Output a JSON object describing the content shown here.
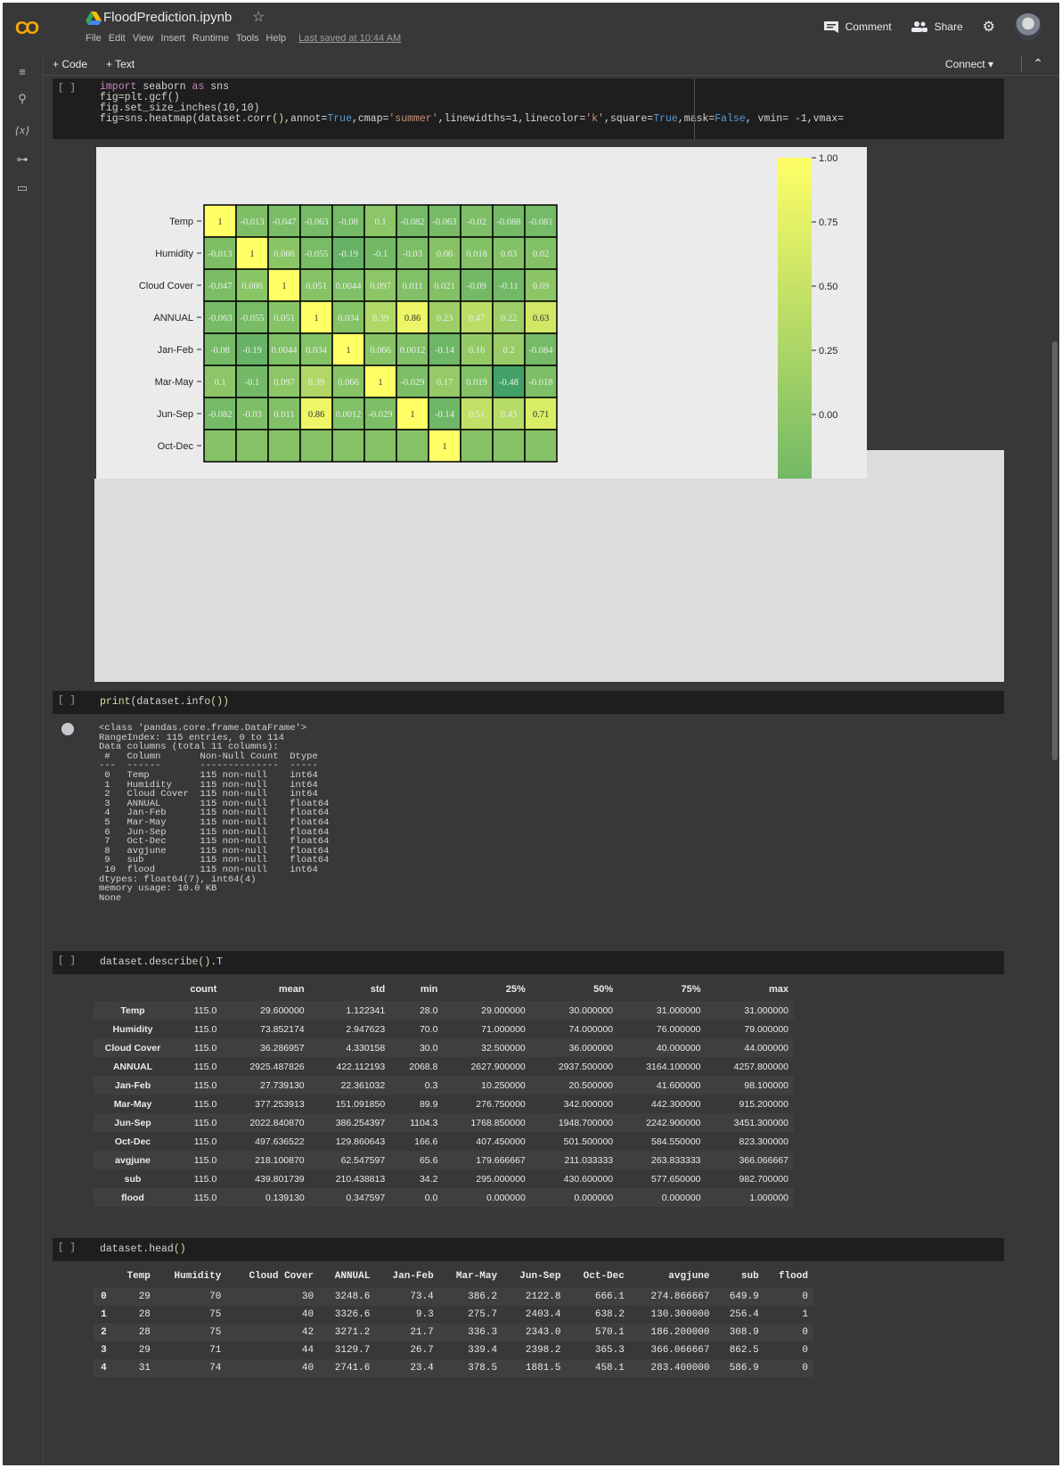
{
  "app": {
    "logo": "CO",
    "notebook_title": "FloodPrediction.ipynb",
    "menu": [
      "File",
      "Edit",
      "View",
      "Insert",
      "Runtime",
      "Tools",
      "Help"
    ],
    "last_saved": "Last saved at 10:44 AM",
    "comment_label": "Comment",
    "share_label": "Share"
  },
  "toolbar": {
    "code_label": "+ Code",
    "text_label": "+ Text",
    "connect_label": "Connect"
  },
  "cells": {
    "run_indicator": "[ ]",
    "heatmap_code": {
      "line1_kw": "import",
      "line1_rest": " seaborn ",
      "line1_kw2": "as",
      "line1_end": " sns",
      "line2": "fig=plt.gcf()",
      "line3": "fig.set_size_inches(10,10)",
      "line4_a": "fig=sns.heatmap(dataset.corr",
      "line4_paren": "()",
      "line4_b": ",annot=",
      "line4_true": "True",
      "line4_c": ",cmap=",
      "line4_cmap": "'summer'",
      "line4_d": ",linewidths=1,linecolor=",
      "line4_k": "'k'",
      "line4_e": ",square=",
      "line4_true2": "True",
      "line4_f": ",mask=",
      "line4_false": "False",
      "line4_g": ", vmin= -1,vmax="
    },
    "info_code": {
      "fn": "print",
      "rest": "(dataset.info",
      "paren": "())"
    },
    "describe_code": {
      "a": "dataset.describe",
      "paren": "()",
      "b": ".T"
    },
    "head_code": {
      "a": "dataset.head",
      "paren": "()"
    }
  },
  "chart_data": {
    "type": "heatmap",
    "row_labels": [
      "Temp",
      "Humidity",
      "Cloud Cover",
      "ANNUAL",
      "Jan-Feb",
      "Mar-May",
      "Jun-Sep",
      "Oct-Dec"
    ],
    "values": [
      [
        "1",
        "-0.013",
        "-0.047",
        "-0.063",
        "-0.08",
        "0.1",
        "-0.082",
        "-0.063",
        "-0.02",
        "-0.088",
        "-0.081"
      ],
      [
        "-0.013",
        "1",
        "0.086",
        "-0.055",
        "-0.19",
        "-0.1",
        "-0.03",
        "0.06",
        "0.018",
        "0.03",
        "0.02"
      ],
      [
        "-0.047",
        "0.086",
        "1",
        "0.051",
        "0.0044",
        "0.097",
        "0.011",
        "0.021",
        "-0.09",
        "-0.11",
        "0.09"
      ],
      [
        "-0.063",
        "-0.055",
        "0.051",
        "1",
        "0.034",
        "0.39",
        "0.86",
        "0.23",
        "0.47",
        "0.22",
        "0.63"
      ],
      [
        "-0.08",
        "-0.19",
        "0.0044",
        "0.034",
        "1",
        "0.066",
        "0.0012",
        "-0.14",
        "0.16",
        "0.2",
        "-0.084"
      ],
      [
        "0.1",
        "-0.1",
        "0.097",
        "0.39",
        "0.066",
        "1",
        "-0.029",
        "0.17",
        "0.019",
        "-0.48",
        "-0.018"
      ],
      [
        "-0.082",
        "-0.03",
        "0.011",
        "0.86",
        "0.0012",
        "-0.029",
        "1",
        "-0.14",
        "0.51",
        "0.43",
        "0.71"
      ],
      [
        "",
        "",
        "",
        "",
        "",
        "",
        "",
        "1",
        "",
        "",
        ""
      ]
    ],
    "colorbar_ticks": [
      "1.00",
      "0.75",
      "0.50",
      "0.25",
      "0.00"
    ],
    "colorbar_range": [
      -1,
      1
    ],
    "colormap": [
      "#008066",
      "#ffff66"
    ],
    "cell_border": "#000000"
  },
  "info_output": "<class 'pandas.core.frame.DataFrame'>\nRangeIndex: 115 entries, 0 to 114\nData columns (total 11 columns):\n #   Column       Non-Null Count  Dtype  \n---  ------       --------------  -----  \n 0   Temp         115 non-null    int64  \n 1   Humidity     115 non-null    int64  \n 2   Cloud Cover  115 non-null    int64  \n 3   ANNUAL       115 non-null    float64\n 4   Jan-Feb      115 non-null    float64\n 5   Mar-May      115 non-null    float64\n 6   Jun-Sep      115 non-null    float64\n 7   Oct-Dec      115 non-null    float64\n 8   avgjune      115 non-null    float64\n 9   sub          115 non-null    float64\n 10  flood        115 non-null    int64  \ndtypes: float64(7), int64(4)\nmemory usage: 10.0 KB\nNone",
  "describe_table": {
    "columns": [
      "",
      "count",
      "mean",
      "std",
      "min",
      "25%",
      "50%",
      "75%",
      "max"
    ],
    "rows": [
      [
        "Temp",
        "115.0",
        "29.600000",
        "1.122341",
        "28.0",
        "29.000000",
        "30.000000",
        "31.000000",
        "31.000000"
      ],
      [
        "Humidity",
        "115.0",
        "73.852174",
        "2.947623",
        "70.0",
        "71.000000",
        "74.000000",
        "76.000000",
        "79.000000"
      ],
      [
        "Cloud Cover",
        "115.0",
        "36.286957",
        "4.330158",
        "30.0",
        "32.500000",
        "36.000000",
        "40.000000",
        "44.000000"
      ],
      [
        "ANNUAL",
        "115.0",
        "2925.487826",
        "422.112193",
        "2068.8",
        "2627.900000",
        "2937.500000",
        "3164.100000",
        "4257.800000"
      ],
      [
        "Jan-Feb",
        "115.0",
        "27.739130",
        "22.361032",
        "0.3",
        "10.250000",
        "20.500000",
        "41.600000",
        "98.100000"
      ],
      [
        "Mar-May",
        "115.0",
        "377.253913",
        "151.091850",
        "89.9",
        "276.750000",
        "342.000000",
        "442.300000",
        "915.200000"
      ],
      [
        "Jun-Sep",
        "115.0",
        "2022.840870",
        "386.254397",
        "1104.3",
        "1768.850000",
        "1948.700000",
        "2242.900000",
        "3451.300000"
      ],
      [
        "Oct-Dec",
        "115.0",
        "497.636522",
        "129.860643",
        "166.6",
        "407.450000",
        "501.500000",
        "584.550000",
        "823.300000"
      ],
      [
        "avgjune",
        "115.0",
        "218.100870",
        "62.547597",
        "65.6",
        "179.666667",
        "211.033333",
        "263.833333",
        "366.066667"
      ],
      [
        "sub",
        "115.0",
        "439.801739",
        "210.438813",
        "34.2",
        "295.000000",
        "430.600000",
        "577.650000",
        "982.700000"
      ],
      [
        "flood",
        "115.0",
        "0.139130",
        "0.347597",
        "0.0",
        "0.000000",
        "0.000000",
        "0.000000",
        "1.000000"
      ]
    ]
  },
  "head_table": {
    "columns": [
      "",
      "Temp",
      "Humidity",
      "Cloud Cover",
      "ANNUAL",
      "Jan-Feb",
      "Mar-May",
      "Jun-Sep",
      "Oct-Dec",
      "avgjune",
      "sub",
      "flood"
    ],
    "rows": [
      [
        "0",
        "29",
        "70",
        "30",
        "3248.6",
        "73.4",
        "386.2",
        "2122.8",
        "666.1",
        "274.866667",
        "649.9",
        "0"
      ],
      [
        "1",
        "28",
        "75",
        "40",
        "3326.6",
        "9.3",
        "275.7",
        "2403.4",
        "638.2",
        "130.300000",
        "256.4",
        "1"
      ],
      [
        "2",
        "28",
        "75",
        "42",
        "3271.2",
        "21.7",
        "336.3",
        "2343.0",
        "570.1",
        "186.200000",
        "308.9",
        "0"
      ],
      [
        "3",
        "29",
        "71",
        "44",
        "3129.7",
        "26.7",
        "339.4",
        "2398.2",
        "365.3",
        "366.066667",
        "862.5",
        "0"
      ],
      [
        "4",
        "31",
        "74",
        "40",
        "2741.6",
        "23.4",
        "378.5",
        "1881.5",
        "458.1",
        "283.400000",
        "586.9",
        "0"
      ]
    ]
  }
}
